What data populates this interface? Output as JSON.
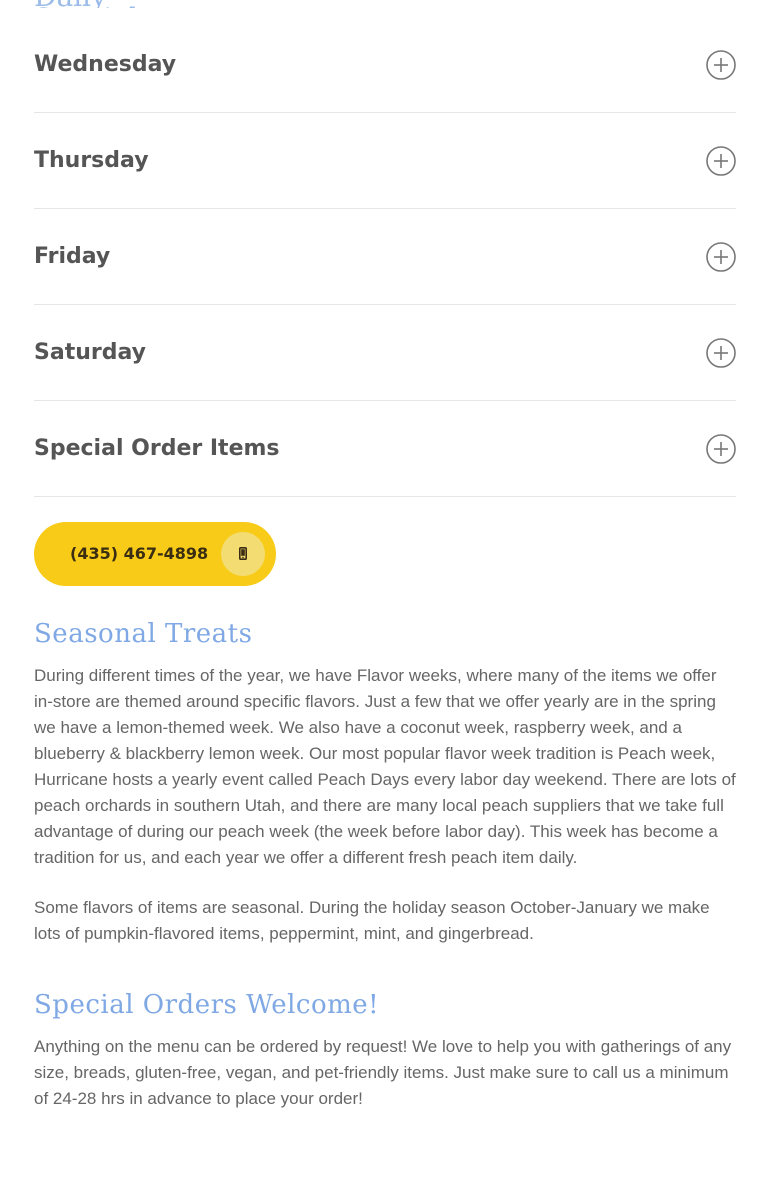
{
  "top_partial_heading": "Daily Specials",
  "accordion": {
    "items": [
      {
        "label": "Wednesday"
      },
      {
        "label": "Thursday"
      },
      {
        "label": "Friday"
      },
      {
        "label": "Saturday"
      },
      {
        "label": "Special Order Items"
      }
    ],
    "toggle_icon": "plus-circle-icon"
  },
  "phone_button": {
    "label": "(435) 467-4898",
    "icon": "mobile-phone-icon",
    "color": "#f7cb17"
  },
  "seasonal": {
    "heading": "Seasonal Treats",
    "paragraph1": "During different times of the year, we have Flavor weeks, where many of the items we offer in-store are themed around specific flavors. Just a few that we offer yearly are in the spring we have a lemon-themed week. We also have a coconut week, raspberry week, and a blueberry & blackberry lemon week. Our most popular flavor week tradition is Peach week, Hurricane hosts a yearly event called Peach Days every labor day weekend. There are lots of peach orchards in southern Utah, and there are many local peach suppliers that we take full advantage of during our peach week (the week before labor day). This week has become a tradition for us, and each year we offer a different fresh peach item daily.",
    "paragraph2": "Some flavors of items are seasonal. During the holiday season October-January we make lots of pumpkin-flavored items, peppermint, mint, and gingerbread."
  },
  "special_orders": {
    "heading": "Special Orders Welcome!",
    "paragraph": "Anything on the menu can be ordered by request! We love to help you with gatherings of any size, breads, gluten-free, vegan, and pet-friendly items. Just make sure to call us a minimum of 24-28 hrs in advance to place your order!"
  },
  "colors": {
    "heading_blue": "#7fa8e4",
    "button_yellow": "#f7cb17",
    "text_gray": "#666666"
  }
}
